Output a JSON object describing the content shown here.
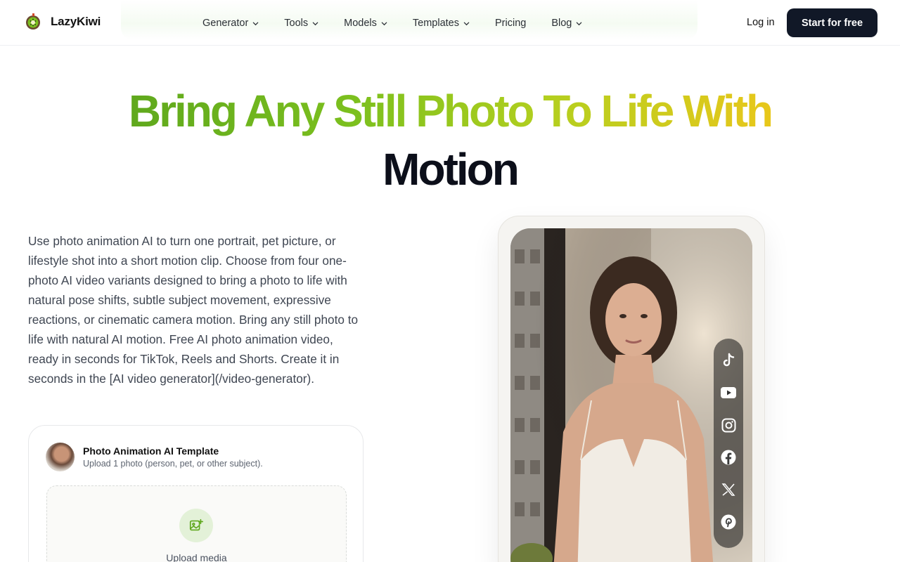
{
  "brand": {
    "name": "LazyKiwi"
  },
  "nav": {
    "items": [
      {
        "label": "Generator",
        "has_dropdown": true
      },
      {
        "label": "Tools",
        "has_dropdown": true
      },
      {
        "label": "Models",
        "has_dropdown": true
      },
      {
        "label": "Templates",
        "has_dropdown": true
      },
      {
        "label": "Pricing",
        "has_dropdown": false
      },
      {
        "label": "Blog",
        "has_dropdown": true
      }
    ],
    "login": "Log in",
    "cta": "Start for free"
  },
  "hero": {
    "title_line1": "Bring Any Still Photo To Life With",
    "title_line2": "Motion",
    "description": "Use photo animation AI to turn one portrait, pet picture, or lifestyle shot into a short motion clip. Choose from four one-photo AI video variants designed to bring a photo to life with natural pose shifts, subtle subject movement, expressive reactions, or cinematic camera motion. Bring any still photo to life with natural AI motion. Free AI photo animation video, ready in seconds for TikTok, Reels and Shorts. Create it in seconds in the [AI video generator](/video-generator)."
  },
  "template_card": {
    "title": "Photo Animation AI Template",
    "subtitle": "Upload 1 photo (person, pet, or other subject).",
    "upload_label": "Upload media"
  },
  "social_icons": [
    "tiktok-icon",
    "youtube-icon",
    "instagram-icon",
    "facebook-icon",
    "x-icon",
    "pinterest-icon"
  ],
  "colors": {
    "cta_bg": "#111827",
    "title_gradient_start": "#5fa81d",
    "title_gradient_end": "#e8c71b",
    "upload_icon_bg": "#e3f1d8"
  }
}
